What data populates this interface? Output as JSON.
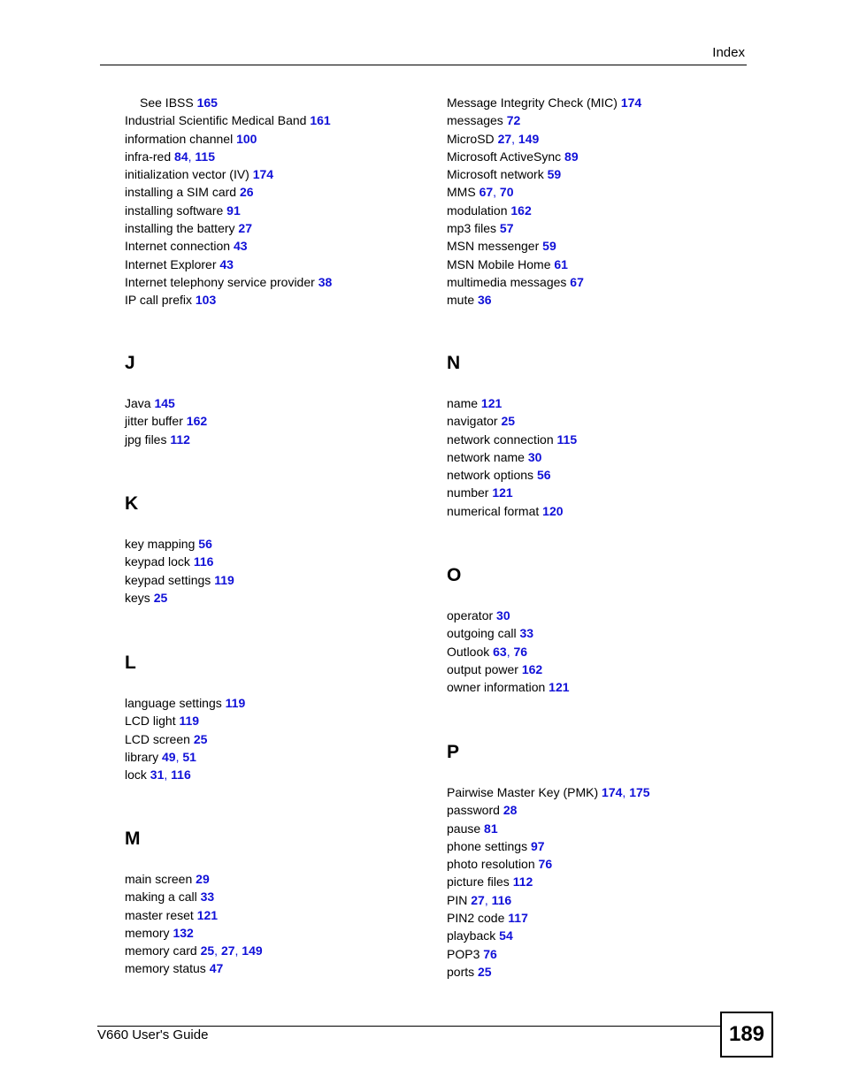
{
  "header": {
    "title": "Index"
  },
  "footer": {
    "guide_title": "V660 User's Guide",
    "page_number": "189"
  },
  "left_column": {
    "continuation": [
      {
        "term": "See IBSS",
        "pages": [
          "165"
        ],
        "indent": true
      },
      {
        "term": "Industrial Scientific Medical Band",
        "pages": [
          "161"
        ]
      },
      {
        "term": "information channel",
        "pages": [
          "100"
        ]
      },
      {
        "term": "infra-red",
        "pages": [
          "84",
          "115"
        ]
      },
      {
        "term": "initialization vector (IV)",
        "pages": [
          "174"
        ]
      },
      {
        "term": "installing a SIM card",
        "pages": [
          "26"
        ]
      },
      {
        "term": "installing software",
        "pages": [
          "91"
        ]
      },
      {
        "term": "installing the battery",
        "pages": [
          "27"
        ]
      },
      {
        "term": "Internet connection",
        "pages": [
          "43"
        ]
      },
      {
        "term": "Internet Explorer",
        "pages": [
          "43"
        ]
      },
      {
        "term": "Internet telephony service provider",
        "pages": [
          "38"
        ]
      },
      {
        "term": "IP call prefix",
        "pages": [
          "103"
        ]
      }
    ],
    "sections": [
      {
        "letter": "J",
        "entries": [
          {
            "term": "Java",
            "pages": [
              "145"
            ]
          },
          {
            "term": "jitter buffer",
            "pages": [
              "162"
            ]
          },
          {
            "term": "jpg files",
            "pages": [
              "112"
            ]
          }
        ]
      },
      {
        "letter": "K",
        "entries": [
          {
            "term": "key mapping",
            "pages": [
              "56"
            ]
          },
          {
            "term": "keypad lock",
            "pages": [
              "116"
            ]
          },
          {
            "term": "keypad settings",
            "pages": [
              "119"
            ]
          },
          {
            "term": "keys",
            "pages": [
              "25"
            ]
          }
        ]
      },
      {
        "letter": "L",
        "entries": [
          {
            "term": "language settings",
            "pages": [
              "119"
            ]
          },
          {
            "term": "LCD light",
            "pages": [
              "119"
            ]
          },
          {
            "term": "LCD screen",
            "pages": [
              "25"
            ]
          },
          {
            "term": "library",
            "pages": [
              "49",
              "51"
            ]
          },
          {
            "term": "lock",
            "pages": [
              "31",
              "116"
            ]
          }
        ]
      },
      {
        "letter": "M",
        "entries": [
          {
            "term": "main screen",
            "pages": [
              "29"
            ]
          },
          {
            "term": "making a call",
            "pages": [
              "33"
            ]
          },
          {
            "term": "master reset",
            "pages": [
              "121"
            ]
          },
          {
            "term": "memory",
            "pages": [
              "132"
            ]
          },
          {
            "term": "memory card",
            "pages": [
              "25",
              "27",
              "149"
            ]
          },
          {
            "term": "memory status",
            "pages": [
              "47"
            ]
          }
        ]
      }
    ]
  },
  "right_column": {
    "continuation": [
      {
        "term": "Message Integrity Check (MIC)",
        "pages": [
          "174"
        ]
      },
      {
        "term": "messages",
        "pages": [
          "72"
        ]
      },
      {
        "term": "MicroSD",
        "pages": [
          "27",
          "149"
        ]
      },
      {
        "term": "Microsoft ActiveSync",
        "pages": [
          "89"
        ]
      },
      {
        "term": "Microsoft network",
        "pages": [
          "59"
        ]
      },
      {
        "term": "MMS",
        "pages": [
          "67",
          "70"
        ]
      },
      {
        "term": "modulation",
        "pages": [
          "162"
        ]
      },
      {
        "term": "mp3 files",
        "pages": [
          "57"
        ]
      },
      {
        "term": "MSN messenger",
        "pages": [
          "59"
        ]
      },
      {
        "term": "MSN Mobile Home",
        "pages": [
          "61"
        ]
      },
      {
        "term": "multimedia messages",
        "pages": [
          "67"
        ]
      },
      {
        "term": "mute",
        "pages": [
          "36"
        ]
      }
    ],
    "sections": [
      {
        "letter": "N",
        "entries": [
          {
            "term": "name",
            "pages": [
              "121"
            ]
          },
          {
            "term": "navigator",
            "pages": [
              "25"
            ]
          },
          {
            "term": "network connection",
            "pages": [
              "115"
            ]
          },
          {
            "term": "network name",
            "pages": [
              "30"
            ]
          },
          {
            "term": "network options",
            "pages": [
              "56"
            ]
          },
          {
            "term": "number",
            "pages": [
              "121"
            ]
          },
          {
            "term": "numerical format",
            "pages": [
              "120"
            ]
          }
        ]
      },
      {
        "letter": "O",
        "entries": [
          {
            "term": "operator",
            "pages": [
              "30"
            ]
          },
          {
            "term": "outgoing call",
            "pages": [
              "33"
            ]
          },
          {
            "term": "Outlook",
            "pages": [
              "63",
              "76"
            ]
          },
          {
            "term": "output power",
            "pages": [
              "162"
            ]
          },
          {
            "term": "owner information",
            "pages": [
              "121"
            ]
          }
        ]
      },
      {
        "letter": "P",
        "entries": [
          {
            "term": "Pairwise Master Key (PMK)",
            "pages": [
              "174",
              "175"
            ]
          },
          {
            "term": "password",
            "pages": [
              "28"
            ]
          },
          {
            "term": "pause",
            "pages": [
              "81"
            ]
          },
          {
            "term": "phone settings",
            "pages": [
              "97"
            ]
          },
          {
            "term": "photo resolution",
            "pages": [
              "76"
            ]
          },
          {
            "term": "picture files",
            "pages": [
              "112"
            ]
          },
          {
            "term": "PIN",
            "pages": [
              "27",
              "116"
            ]
          },
          {
            "term": "PIN2 code",
            "pages": [
              "117"
            ]
          },
          {
            "term": "playback",
            "pages": [
              "54"
            ]
          },
          {
            "term": "POP3",
            "pages": [
              "76"
            ]
          },
          {
            "term": "ports",
            "pages": [
              "25"
            ]
          }
        ]
      }
    ]
  }
}
